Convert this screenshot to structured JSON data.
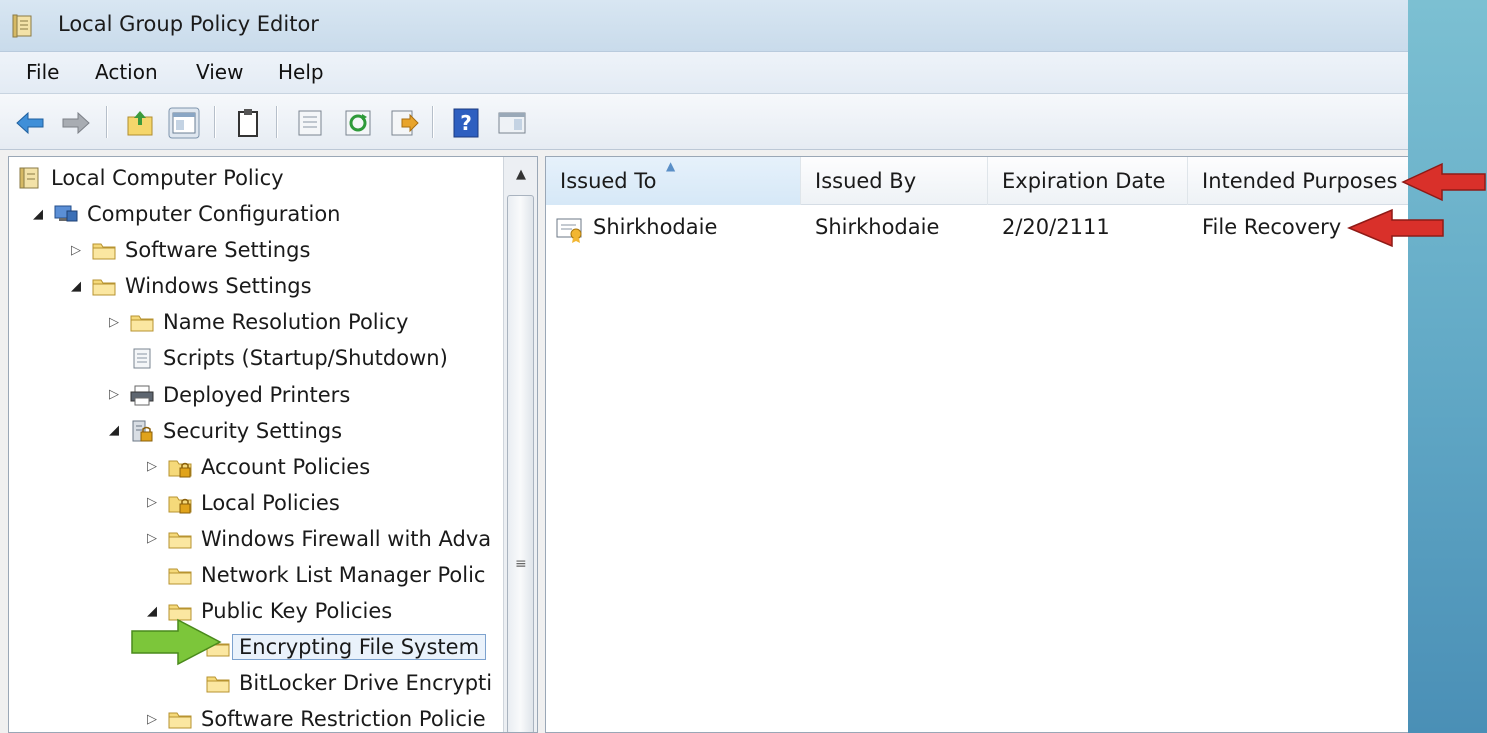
{
  "window": {
    "title": "Local Group Policy Editor"
  },
  "menu": [
    "File",
    "Action",
    "View",
    "Help"
  ],
  "toolbar": {
    "icons": [
      "back-arrow-icon",
      "forward-arrow-icon",
      "up-folder-icon",
      "show-hide-console-tree-icon",
      "properties-clipboard-icon",
      "export-list-icon",
      "refresh-icon",
      "export-icon",
      "help-icon",
      "action-pane-icon"
    ]
  },
  "tree": {
    "root": "Local Computer Policy",
    "items": [
      {
        "label": "Computer Configuration",
        "expander": "open",
        "icon": "computer-icon"
      },
      {
        "label": "Software Settings",
        "expander": "closed",
        "icon": "folder-icon"
      },
      {
        "label": "Windows Settings",
        "expander": "open",
        "icon": "folder-icon"
      },
      {
        "label": "Name Resolution Policy",
        "expander": "closed",
        "icon": "folder-icon"
      },
      {
        "label": "Scripts (Startup/Shutdown)",
        "expander": "none",
        "icon": "script-icon"
      },
      {
        "label": "Deployed Printers",
        "expander": "closed",
        "icon": "printer-icon"
      },
      {
        "label": "Security Settings",
        "expander": "open",
        "icon": "security-settings-icon"
      },
      {
        "label": "Account Policies",
        "expander": "closed",
        "icon": "locked-folder-icon"
      },
      {
        "label": "Local Policies",
        "expander": "closed",
        "icon": "locked-folder-icon"
      },
      {
        "label": "Windows Firewall with Adva",
        "expander": "closed",
        "icon": "folder-icon"
      },
      {
        "label": "Network List Manager Polic",
        "expander": "none",
        "icon": "folder-icon"
      },
      {
        "label": "Public Key Policies",
        "expander": "open",
        "icon": "folder-icon"
      },
      {
        "label": "Encrypting File System",
        "expander": "none",
        "icon": "folder-icon",
        "selected": true
      },
      {
        "label": "BitLocker Drive Encrypti",
        "expander": "none",
        "icon": "folder-icon"
      },
      {
        "label": "Software Restriction Policie",
        "expander": "closed",
        "icon": "folder-icon"
      }
    ]
  },
  "list": {
    "columns": [
      "Issued To",
      "Issued By",
      "Expiration Date",
      "Intended Purposes"
    ],
    "sorted_column": "Issued To",
    "rows": [
      {
        "issued_to": "Shirkhodaie",
        "issued_by": "Shirkhodaie",
        "expiration_date": "2/20/2111",
        "intended_purposes": "File Recovery"
      }
    ]
  },
  "annotations": {
    "arrow_colors": {
      "red": "#d9302a",
      "green": "#7cc63a"
    }
  }
}
